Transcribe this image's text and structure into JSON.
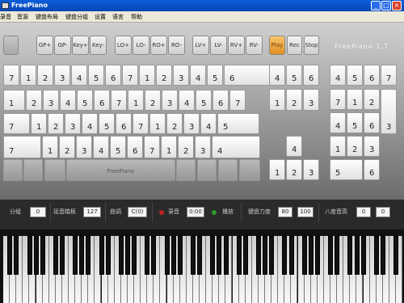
{
  "window": {
    "title": "FreePiano"
  },
  "menu": [
    "录音",
    "音源",
    "键盘布局",
    "键盘分组",
    "设置",
    "语言",
    "帮助"
  ],
  "function_keys": [
    "GP+",
    "GP-",
    "Key+",
    "Key-",
    "LO+",
    "LO-",
    "RO+",
    "RO-",
    "LV+",
    "LV-",
    "RV+",
    "RV-",
    "Play",
    "Rec",
    "Stop"
  ],
  "brand": "FreePiano 1.7",
  "keyboard": {
    "rows": [
      [
        [
          "7",
          ""
        ],
        [
          "1",
          ""
        ],
        [
          "2",
          ""
        ],
        [
          "3",
          ""
        ],
        [
          "4",
          ""
        ],
        [
          "5",
          ""
        ],
        [
          "6",
          ""
        ],
        [
          "7",
          ""
        ],
        [
          "1",
          ""
        ],
        [
          "2",
          ""
        ],
        [
          "3",
          ""
        ],
        [
          "4",
          ""
        ],
        [
          "5",
          ""
        ],
        [
          "6",
          ""
        ]
      ],
      [
        [
          "1",
          ""
        ],
        [
          "2",
          ""
        ],
        [
          "3",
          ""
        ],
        [
          "4",
          ""
        ],
        [
          "5",
          ""
        ],
        [
          "6",
          ""
        ],
        [
          "7",
          ""
        ],
        [
          "1",
          ""
        ],
        [
          "2",
          ""
        ],
        [
          "3",
          ""
        ],
        [
          "4",
          ""
        ],
        [
          "5",
          ""
        ],
        [
          "6",
          ""
        ],
        [
          "7",
          ""
        ]
      ],
      [
        [
          "7",
          ""
        ],
        [
          "1",
          ""
        ],
        [
          "2",
          ""
        ],
        [
          "3",
          ""
        ],
        [
          "4",
          ""
        ],
        [
          "5",
          ""
        ],
        [
          "6",
          ""
        ],
        [
          "7",
          ""
        ],
        [
          "1",
          ""
        ],
        [
          "2",
          ""
        ],
        [
          "3",
          ""
        ],
        [
          "4",
          ""
        ],
        [
          "5",
          ""
        ]
      ],
      [
        [
          "7",
          ""
        ],
        [
          "1",
          ""
        ],
        [
          "2",
          ""
        ],
        [
          "3",
          ""
        ],
        [
          "4",
          ""
        ],
        [
          "5",
          ""
        ],
        [
          "6",
          ""
        ],
        [
          "7",
          ""
        ],
        [
          "1",
          ""
        ],
        [
          "2",
          ""
        ],
        [
          "3",
          ""
        ],
        [
          "4",
          ""
        ]
      ],
      [
        [
          "",
          ""
        ],
        [
          "",
          ""
        ],
        [
          "",
          ""
        ],
        [
          "FreePiano",
          ""
        ],
        [
          "",
          ""
        ],
        [
          "",
          ""
        ],
        [
          "",
          ""
        ],
        [
          "",
          ""
        ]
      ]
    ],
    "nav": [
      [
        "4",
        ""
      ],
      [
        "5",
        ""
      ],
      [
        "6",
        ""
      ],
      [
        "1",
        ""
      ],
      [
        "2",
        ""
      ],
      [
        "3",
        ""
      ],
      [
        "4",
        ""
      ],
      [
        "1",
        ""
      ],
      [
        "2",
        ""
      ],
      [
        "3",
        ""
      ]
    ],
    "numpad": [
      [
        "4",
        ""
      ],
      [
        "5",
        ""
      ],
      [
        "6",
        ""
      ],
      [
        "7",
        ""
      ],
      [
        "7",
        ""
      ],
      [
        "1",
        ""
      ],
      [
        "2",
        ""
      ],
      [
        "3",
        ""
      ],
      [
        "4",
        ""
      ],
      [
        "5",
        ""
      ],
      [
        "6",
        ""
      ],
      [
        "1",
        ""
      ],
      [
        "2",
        ""
      ],
      [
        "3",
        ""
      ],
      [
        "5",
        ""
      ],
      [
        "6",
        ""
      ]
    ],
    "spacebar_label": "FreePiano"
  },
  "status": {
    "group_label": "分组",
    "group_value": "0",
    "sustain_label": "延音踏板",
    "sustain_value": "127",
    "key_label": "曲调",
    "key_value": "C(0)",
    "record_label": "录音",
    "record_time": "0:00",
    "play_label": "播放",
    "velocity_label": "键盘力度",
    "velocity_left": "80",
    "velocity_right": "100",
    "octave_label": "八度音高",
    "octave_left": "0",
    "octave_right": "0"
  },
  "colors": {
    "titlebar": "#0a5fd8",
    "play_button": "#e39021",
    "record_dot": "#c02020",
    "play_dot": "#2a9a2a"
  }
}
